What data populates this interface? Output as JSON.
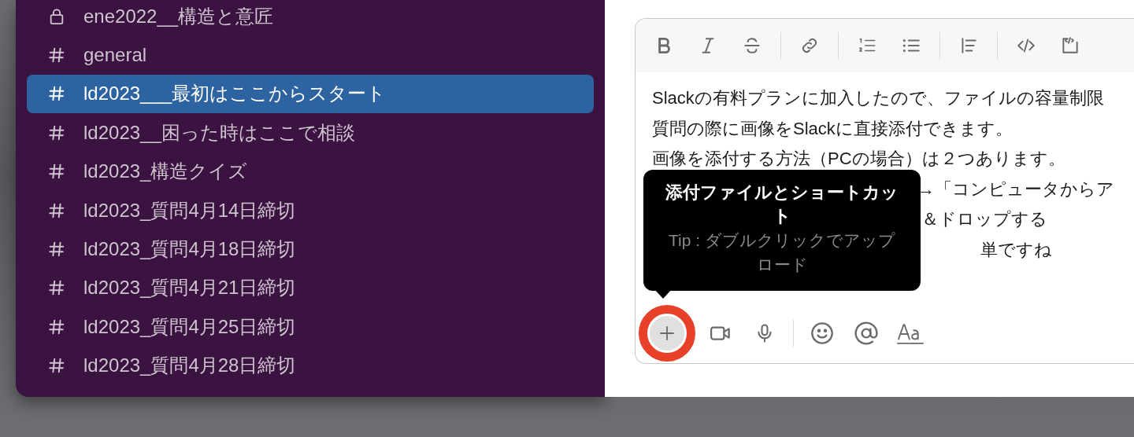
{
  "sidebar": {
    "channels": [
      {
        "name": "ene2022__構造と意匠",
        "kind": "private",
        "selected": false
      },
      {
        "name": "general",
        "kind": "public",
        "selected": false
      },
      {
        "name": "ld2023___最初はここからスタート",
        "kind": "public",
        "selected": true
      },
      {
        "name": "ld2023__困った時はここで相談",
        "kind": "public",
        "selected": false
      },
      {
        "name": "ld2023_構造クイズ",
        "kind": "public",
        "selected": false
      },
      {
        "name": "ld2023_質問4月14日締切",
        "kind": "public",
        "selected": false
      },
      {
        "name": "ld2023_質問4月18日締切",
        "kind": "public",
        "selected": false
      },
      {
        "name": "ld2023_質問4月21日締切",
        "kind": "public",
        "selected": false
      },
      {
        "name": "ld2023_質問4月25日締切",
        "kind": "public",
        "selected": false
      },
      {
        "name": "ld2023_質問4月28日締切",
        "kind": "public",
        "selected": false
      }
    ]
  },
  "composer": {
    "message_lines": [
      {
        "text": "Slackの有料プランに加入したので、ファイルの容量制限",
        "covered": false
      },
      {
        "text": "質問の際に画像をSlackに直接添付できます。",
        "covered": false
      },
      {
        "text": "画像を添付する方法（PCの場合）は２つあります。",
        "covered": false
      },
      {
        "text": "→「コンピュータからア",
        "covered": true
      },
      {
        "text": "＆ドロップする",
        "covered": true
      },
      {
        "text": "単ですね",
        "covered": true
      }
    ],
    "tooltip": {
      "title": "添付ファイルとショートカット",
      "tip": "Tip : ダブルクリックでアップロード"
    }
  }
}
